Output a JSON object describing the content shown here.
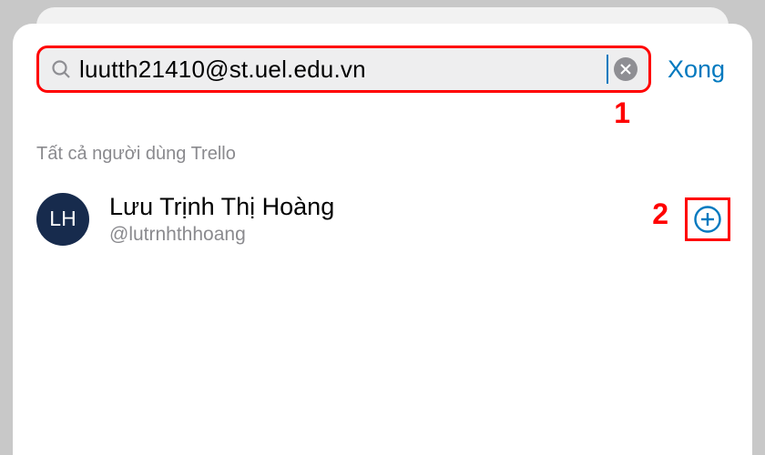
{
  "search": {
    "value": "luutth21410@st.uel.edu.vn",
    "done_label": "Xong"
  },
  "section_header": "Tất cả người dùng Trello",
  "user": {
    "initials": "LH",
    "name": "Lưu Trịnh Thị Hoàng",
    "handle": "@lutrnhthhoang"
  },
  "annotations": {
    "one": "1",
    "two": "2"
  },
  "colors": {
    "accent": "#0079bf",
    "highlight": "#ff0000",
    "avatar_bg": "#172b4d"
  }
}
